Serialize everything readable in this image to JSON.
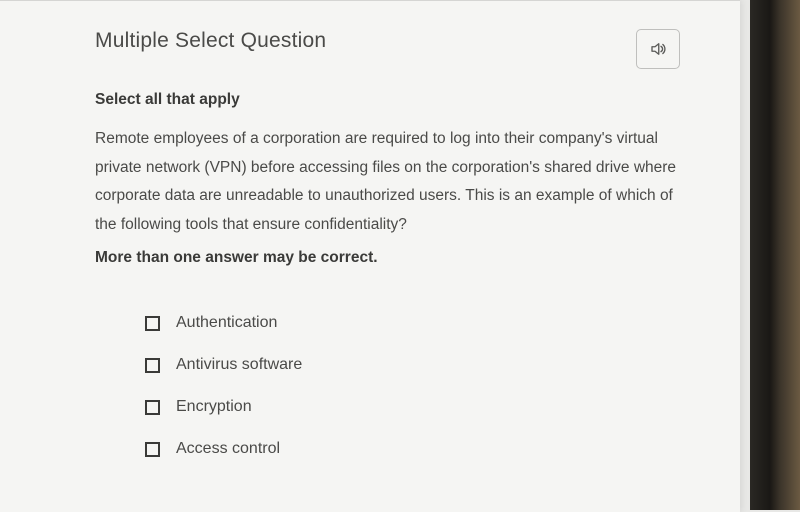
{
  "question_type": "Multiple Select Question",
  "instruction": "Select all that apply",
  "prompt": "Remote employees of a corporation are required to log into their company's virtual private network (VPN) before accessing files on the corporation's shared drive where corporate data are unreadable to unauthorized users. This is an example of which of the following tools that ensure confidentiality?",
  "note": "More than one answer may be correct.",
  "options": [
    {
      "label": "Authentication",
      "checked": false
    },
    {
      "label": "Antivirus software",
      "checked": false
    },
    {
      "label": "Encryption",
      "checked": false
    },
    {
      "label": "Access control",
      "checked": false
    }
  ],
  "icons": {
    "audio": "speaker-icon"
  }
}
